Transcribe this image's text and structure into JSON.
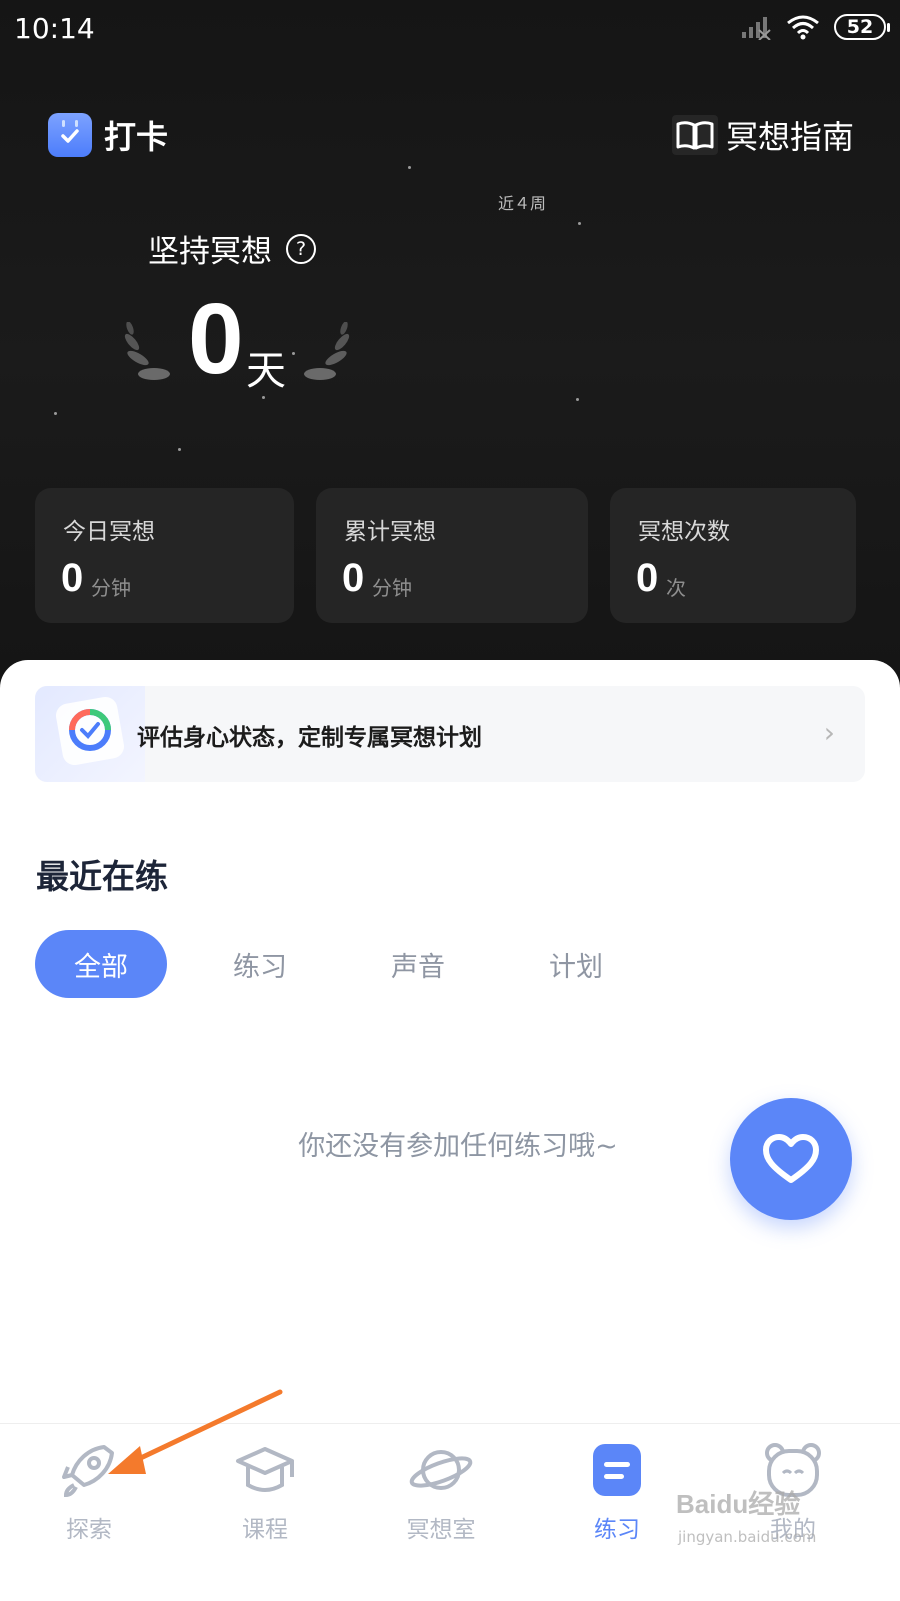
{
  "status_bar": {
    "time": "10:14",
    "battery": "52"
  },
  "header": {
    "checkin_label": "打卡",
    "guide_label": "冥想指南"
  },
  "weeks_label": "近４周",
  "streak": {
    "label": "坚持冥想",
    "help": "?",
    "value": "0",
    "unit": "天"
  },
  "stats": [
    {
      "label": "今日冥想",
      "value": "0",
      "unit": "分钟"
    },
    {
      "label": "累计冥想",
      "value": "0",
      "unit": "分钟"
    },
    {
      "label": "冥想次数",
      "value": "0",
      "unit": "次"
    }
  ],
  "assessment": {
    "text": "评估身心状态，定制专属冥想计划",
    "chevron": "›"
  },
  "recent": {
    "title": "最近在练",
    "tabs": [
      "全部",
      "练习",
      "声音",
      "计划"
    ],
    "active_tab": "全部",
    "empty_text": "你还没有参加任何练习哦~"
  },
  "nav": [
    {
      "label": "探索",
      "icon": "rocket-icon"
    },
    {
      "label": "课程",
      "icon": "graduation-cap-icon"
    },
    {
      "label": "冥想室",
      "icon": "planet-icon"
    },
    {
      "label": "练习",
      "icon": "practice-icon",
      "active": true
    },
    {
      "label": "我的",
      "icon": "bear-icon"
    }
  ],
  "watermark": {
    "text": "Baidu经验",
    "sub": "jingyan.baidu.com"
  },
  "colors": {
    "accent": "#5b86f8",
    "dark_bg": "#161616",
    "card_bg": "#252525"
  }
}
